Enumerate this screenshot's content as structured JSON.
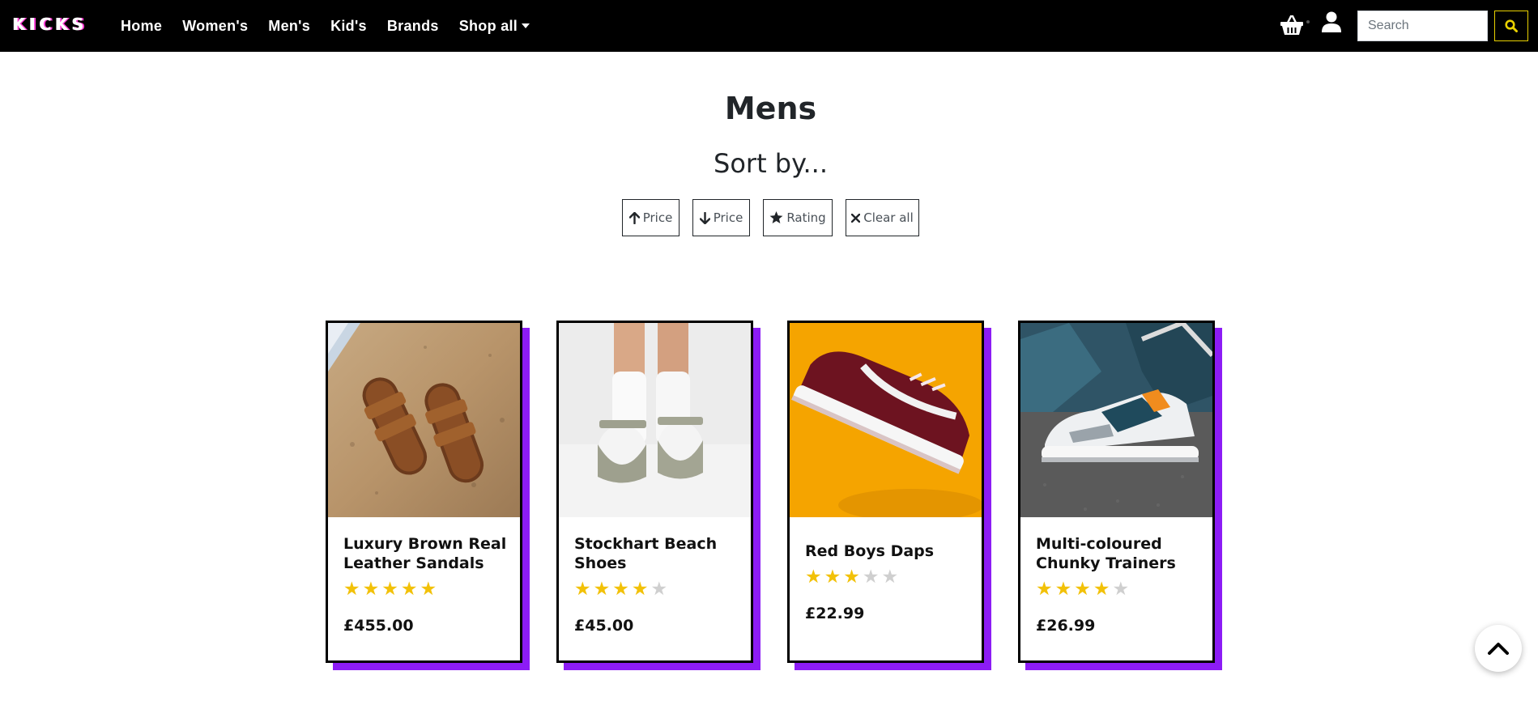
{
  "brand": "KICKS",
  "nav": {
    "links": [
      "Home",
      "Women's",
      "Men's",
      "Kid's",
      "Brands",
      "Shop all"
    ],
    "icons": {
      "basket": "basket-icon",
      "user": "user-icon",
      "search": "search-icon"
    }
  },
  "search": {
    "placeholder": "Search",
    "value": ""
  },
  "page": {
    "title": "Mens",
    "sort_heading": "Sort by..."
  },
  "sort_buttons": [
    {
      "label": "Price",
      "icon": "arrow-up-icon"
    },
    {
      "label": "Price",
      "icon": "arrow-down-icon"
    },
    {
      "label": "Rating",
      "icon": "star-icon"
    },
    {
      "label": "Clear all",
      "icon": "close-icon"
    }
  ],
  "products": [
    {
      "name": "Luxury Brown Real Leather Sandals",
      "rating": 5,
      "max_rating": 5,
      "price": "£455.00",
      "image": "brown-leather-sandals-on-sand"
    },
    {
      "name": "Stockhart Beach Shoes",
      "rating": 4,
      "max_rating": 5,
      "price": "£45.00",
      "image": "grey-sandals-with-white-socks"
    },
    {
      "name": "Red Boys Daps",
      "rating": 3,
      "max_rating": 5,
      "price": "£22.99",
      "image": "maroon-sneaker-on-orange"
    },
    {
      "name": "Multi-coloured Chunky Trainers",
      "rating": 4,
      "max_rating": 5,
      "price": "£26.99",
      "image": "chunky-trainer-on-asphalt"
    }
  ],
  "colors": {
    "nav_bg": "#000000",
    "card_shadow": "#8c1cf5",
    "star_on": "#f2c108",
    "star_off": "#cfcfcf",
    "search_btn_border": "#e8d000"
  },
  "back_to_top_icon": "chevron-up-icon"
}
